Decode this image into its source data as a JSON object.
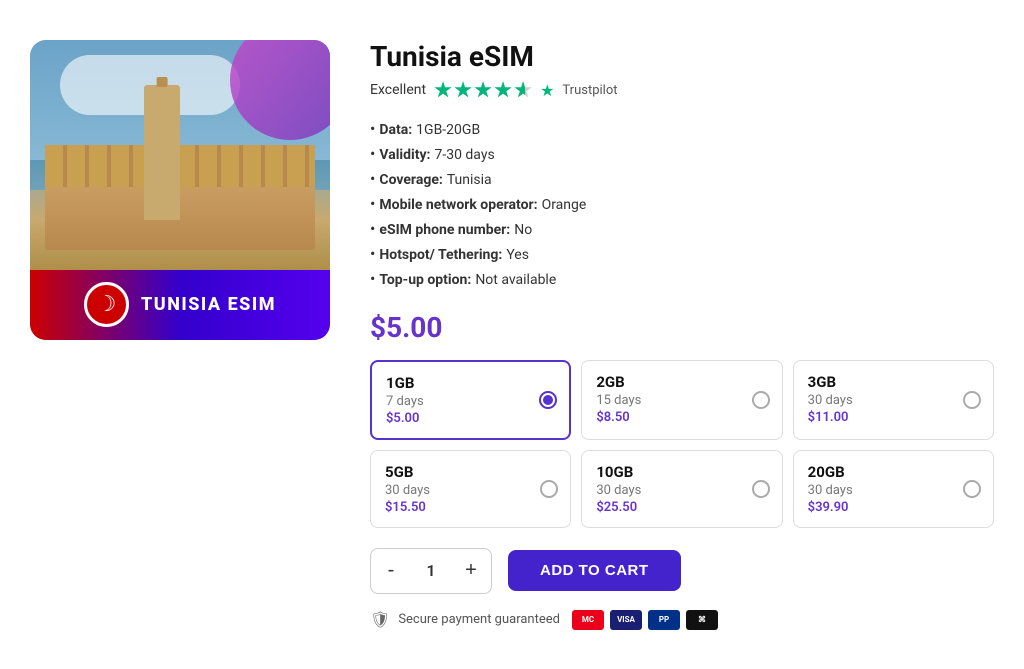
{
  "product": {
    "title": "Tunisia eSIM",
    "rating": {
      "label": "Excellent",
      "trustpilot": "Trustpilot",
      "stars": 4.5
    },
    "specs": [
      {
        "label": "Data:",
        "value": "1GB-20GB"
      },
      {
        "label": "Validity:",
        "value": "7-30 days"
      },
      {
        "label": "Coverage:",
        "value": "Tunisia"
      },
      {
        "label": "Mobile network operator:",
        "value": "Orange"
      },
      {
        "label": "eSIM phone number:",
        "value": "No"
      },
      {
        "label": "Hotspot/ Tethering:",
        "value": "Yes"
      },
      {
        "label": "Top-up option:",
        "value": "Not available"
      }
    ],
    "price": "$5.00",
    "plans": [
      {
        "id": "1gb",
        "name": "1GB",
        "days": "7 days",
        "price": "$5.00",
        "selected": true
      },
      {
        "id": "2gb",
        "name": "2GB",
        "days": "15 days",
        "price": "$8.50",
        "selected": false
      },
      {
        "id": "3gb",
        "name": "3GB",
        "days": "30 days",
        "price": "$11.00",
        "selected": false
      },
      {
        "id": "5gb",
        "name": "5GB",
        "days": "30 days",
        "price": "$15.50",
        "selected": false
      },
      {
        "id": "10gb",
        "name": "10GB",
        "days": "30 days",
        "price": "$25.50",
        "selected": false
      },
      {
        "id": "20gb",
        "name": "20GB",
        "days": "30 days",
        "price": "$39.90",
        "selected": false
      }
    ],
    "quantity": "1",
    "add_to_cart_label": "ADD TO CART",
    "minus_label": "-",
    "plus_label": "+",
    "secure_label": "Secure payment guaranteed",
    "image_banner_text": "TUNISIA ESIM",
    "payment_methods": [
      "MC",
      "VISA",
      "PP",
      "A"
    ]
  }
}
